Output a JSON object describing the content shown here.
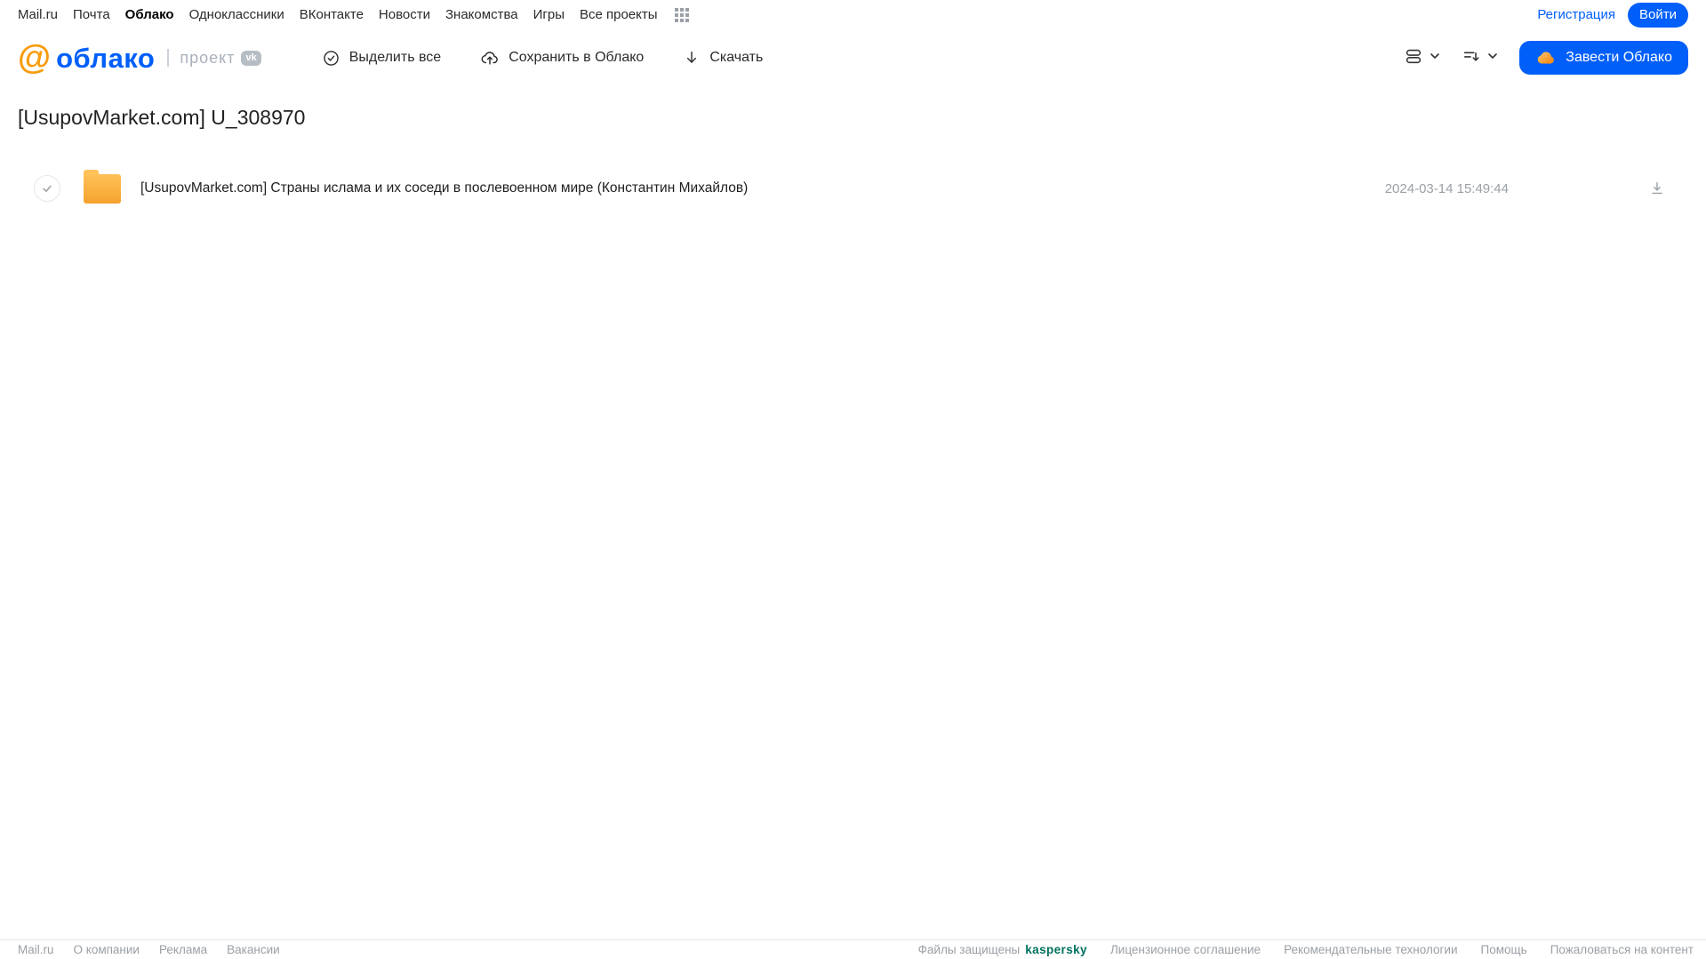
{
  "top_nav": {
    "links": [
      "Mail.ru",
      "Почта",
      "Облако",
      "Одноклассники",
      "ВКонтакте",
      "Новости",
      "Знакомства",
      "Игры",
      "Все проекты"
    ],
    "active_link": "Облако",
    "registration_label": "Регистрация",
    "login_label": "Войти"
  },
  "header": {
    "logo_at": "@",
    "logo_word": "облако",
    "project_label": "проект",
    "vk_badge": "vk",
    "toolbar": [
      {
        "label": "Выделить все",
        "icon": "check-circle-icon"
      },
      {
        "label": "Сохранить в Облако",
        "icon": "cloud-upload-icon"
      },
      {
        "label": "Скачать",
        "icon": "download-arrow-icon"
      }
    ],
    "view_control_icon": "view-mode-icon",
    "sort_control_icon": "sort-icon",
    "get_cloud_button": "Завести Облако"
  },
  "main": {
    "title": "[UsupovMarket.com] U_308970",
    "files": [
      {
        "type": "folder",
        "name": "[UsupovMarket.com] Страны ислама и их соседи в послевоенном мире (Константин Михайлов)",
        "date": "2024-03-14 15:49:44"
      }
    ]
  },
  "footer": {
    "left_links": [
      "Mail.ru",
      "О компании",
      "Реклама",
      "Вакансии"
    ],
    "protected_label": "Файлы защищены",
    "kaspersky_label": "kaspersky",
    "right_links": [
      "Лицензионное соглашение",
      "Рекомендательные технологии",
      "Помощь",
      "Пожаловаться на контент"
    ]
  },
  "colors": {
    "accent_blue": "#005FF9",
    "logo_orange": "#F89C0E",
    "folder_orange": "#F5A22E",
    "kaspersky_green": "#00725F",
    "muted_gray": "#9BA0A5"
  },
  "icons": {
    "all_projects": "grid-dots-icon",
    "select_all": "check-circle-icon",
    "save_to_cloud": "cloud-upload-icon",
    "download": "download-arrow-icon",
    "view_mode": "view-mode-icon",
    "sort": "sort-icon",
    "chevron": "chevron-down-icon",
    "button_cloud": "cloud-icon",
    "row_checkbox": "check-circle",
    "folder": "folder-icon",
    "row_download": "download-underline-icon"
  }
}
